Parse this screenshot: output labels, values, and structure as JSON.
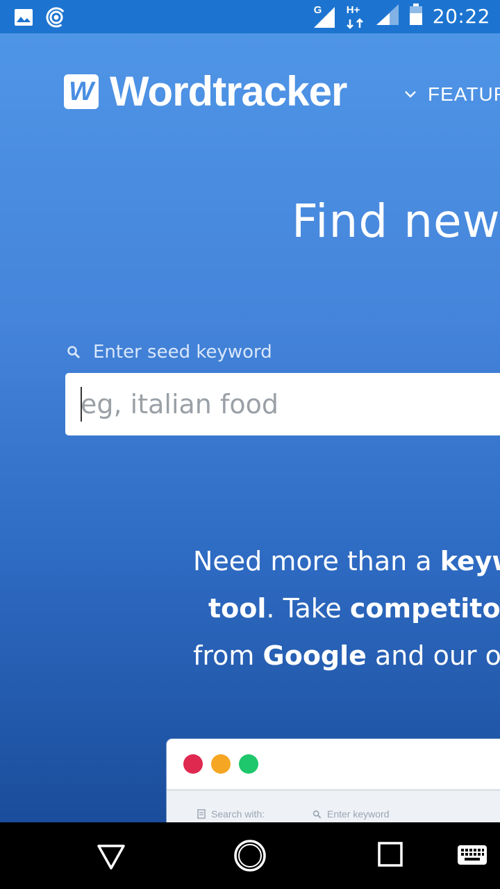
{
  "status_bar": {
    "time": "20:22",
    "network_type": "G",
    "data_type": "H+",
    "icons": [
      "image-icon",
      "hotspot-icon",
      "signal-icon",
      "battery-icon"
    ]
  },
  "header": {
    "logo_mark": "W",
    "logo_text": "Wordtracker",
    "nav_features": "FEATURES"
  },
  "hero": {
    "title": "Find new"
  },
  "search": {
    "label": "Enter seed keyword",
    "placeholder": "eg, italian food"
  },
  "tagline": {
    "l1_a": "Need more than a ",
    "l1_b": "keyword",
    "l2_a": "tool",
    "l2_b": ". Take ",
    "l2_c": "competitors",
    "l3_a": "from ",
    "l3_b": "Google",
    "l3_c": " and our own"
  },
  "preview": {
    "search_with": "Search with:",
    "keyword_placeholder": "Enter keyword",
    "dot_colors": [
      "#e0294f",
      "#f5a623",
      "#1ec76b"
    ]
  },
  "colors": {
    "status_bar": "#1c74d0",
    "brand_blue": "#4a8ee3"
  }
}
